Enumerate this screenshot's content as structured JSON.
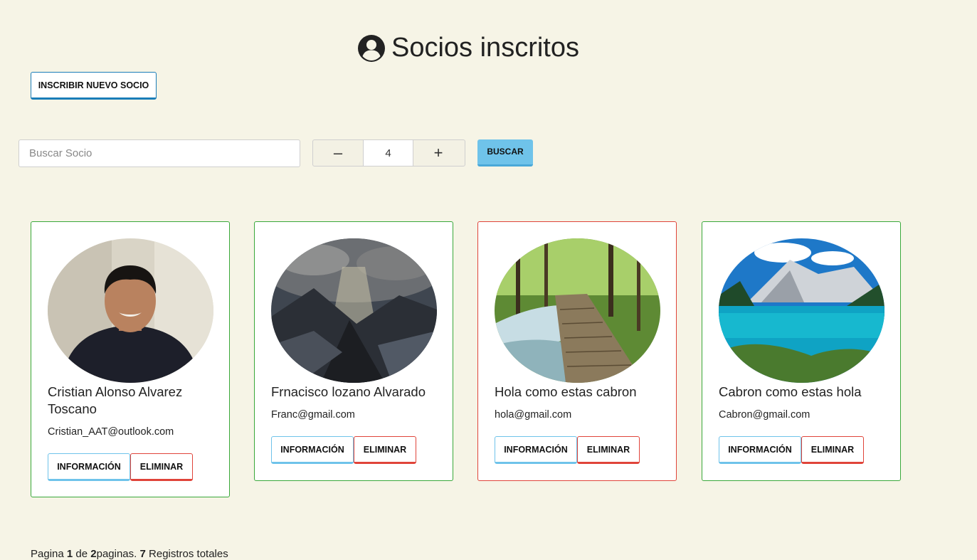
{
  "header": {
    "title": "Socios inscritos",
    "icon": "user-circle-icon"
  },
  "toolbar": {
    "new_label": "INSCRIBIR NUEVO SOCIO"
  },
  "search": {
    "placeholder": "Buscar Socio",
    "value": "",
    "button_label": "BUSCAR"
  },
  "stepper": {
    "minus": "–",
    "value": "4",
    "plus": "+"
  },
  "cards": [
    {
      "name": "Cristian Alonso Alvarez Toscano",
      "email": "Cristian_AAT@outlook.com",
      "info_label": "INFORMACIÓN",
      "delete_label": "ELIMINAR",
      "border_color": "#39a83a",
      "image": "portrait-photo"
    },
    {
      "name": "Frnacisco lozano Alvarado",
      "email": "Franc@gmail.com",
      "info_label": "INFORMACIÓN",
      "delete_label": "ELIMINAR",
      "border_color": "#39a83a",
      "image": "mountain-sunbeam-photo"
    },
    {
      "name": "Hola como estas cabron",
      "email": "hola@gmail.com",
      "info_label": "INFORMACIÓN",
      "delete_label": "ELIMINAR",
      "border_color": "#e0443a",
      "image": "forest-boardwalk-photo"
    },
    {
      "name": "Cabron como estas hola",
      "email": "Cabron@gmail.com",
      "info_label": "INFORMACIÓN",
      "delete_label": "ELIMINAR",
      "border_color": "#39a83a",
      "image": "alpine-lake-photo"
    }
  ],
  "pagination": {
    "label_pagina": "Pagina",
    "current": "1",
    "label_de": "de",
    "total": "2",
    "label_paginas": "paginas.",
    "records": "7",
    "label_registros": "Registros totales"
  },
  "colors": {
    "background": "#f6f4e6",
    "accent": "#1a7db8",
    "info": "#6fc3ea",
    "danger": "#e0443a",
    "active": "#39a83a"
  }
}
